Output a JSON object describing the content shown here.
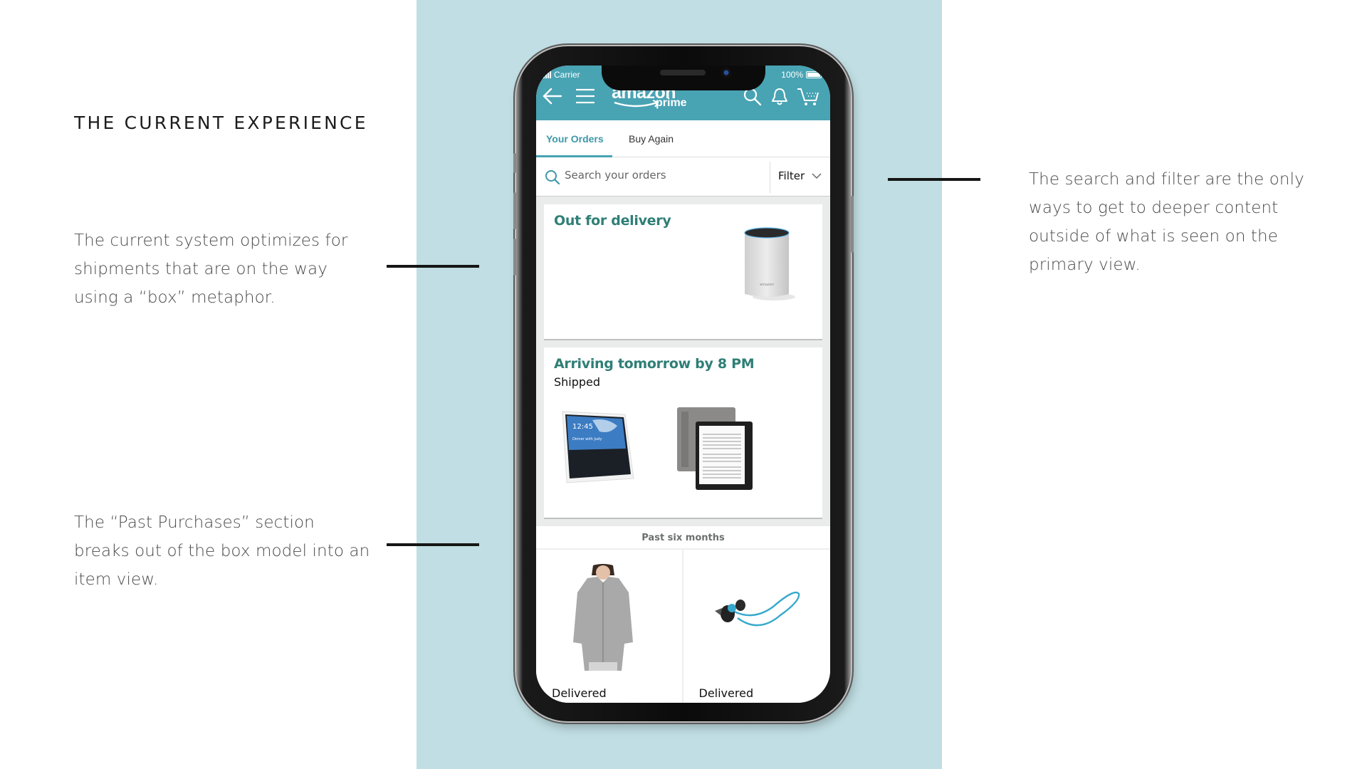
{
  "slide": {
    "heading": "THE CURRENT EXPERIENCE",
    "notes": [
      "The current system optimizes for shipments that are on the way using a “box” metaphor.",
      "The “Past Purchases” section breaks out of the box model into an item view.",
      "The search and filter are the only ways to get to deeper content outside of what is seen on the primary view."
    ],
    "colors": {
      "panel": "#c0dee3",
      "brand": "#48a3b3",
      "status_green": "#2e7f76"
    }
  },
  "phone": {
    "status_bar": {
      "carrier": "Carrier",
      "battery": "100%"
    },
    "nav": {
      "logo_word": "amazon",
      "logo_sub": "prime",
      "icons": [
        "back-arrow-icon",
        "menu-icon",
        "search-icon",
        "bell-icon",
        "cart-icon"
      ]
    },
    "tabs": [
      {
        "label": "Your Orders",
        "active": true
      },
      {
        "label": "Buy Again",
        "active": false
      }
    ],
    "search": {
      "placeholder": "Search your orders",
      "filter_label": "Filter"
    },
    "orders": [
      {
        "title": "Out for delivery",
        "subtitle": "",
        "items": [
          "Amazon Echo speaker"
        ]
      },
      {
        "title": "Arriving tomorrow by 8 PM",
        "subtitle": "Shipped",
        "items": [
          "Echo Show",
          "Kindle Oasis"
        ]
      }
    ],
    "past": {
      "header": "Past six months",
      "items": [
        {
          "product": "Gray zip hoodie",
          "status": "Delivered"
        },
        {
          "product": "Wireless earbuds",
          "status": "Delivered"
        }
      ]
    },
    "echo_show_screen": {
      "time": "12:45",
      "caption": "Dinner with Judy"
    }
  }
}
